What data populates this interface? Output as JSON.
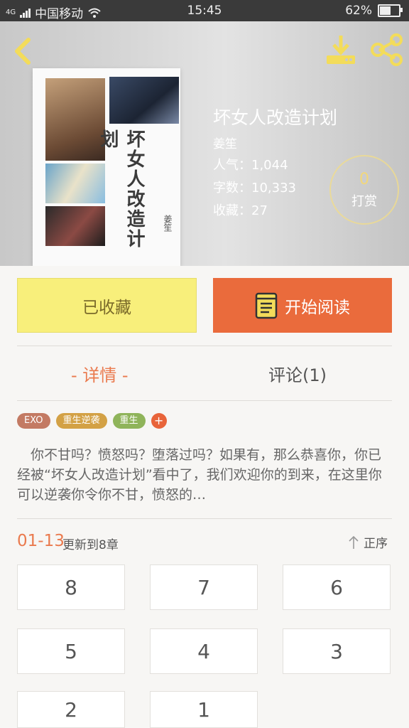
{
  "status": {
    "carrier": "中国移动",
    "network": "4G",
    "time": "15:45",
    "battery": "62%",
    "battery_level": 0.62
  },
  "book": {
    "cover_title": "坏女人改造计划",
    "cover_author": "姜笙",
    "title": "坏女人改造计划",
    "author": "姜笙",
    "popularity": "人气：1,044",
    "words": "字数：10,333",
    "favorites": "收藏：27"
  },
  "tip": {
    "count": "0",
    "label": "打赏"
  },
  "actions": {
    "favorited": "已收藏",
    "read": "开始阅读"
  },
  "tabs": {
    "detail": "- 详情 -",
    "comments": "评论(1)"
  },
  "tags": [
    {
      "label": "EXO",
      "color": "#c37a63"
    },
    {
      "label": "重生逆袭",
      "color": "#d3a145"
    },
    {
      "label": "重生",
      "color": "#8fb45a"
    },
    {
      "label": "+",
      "color": "#e8643a"
    }
  ],
  "description": "你不甘吗？愤怒吗？堕落过吗？如果有，那么恭喜你，你已经被“坏女人改造计划”看中了，我们欢迎你的到来，在这里你可以逆袭你令你不甘，愤怒的…",
  "update": {
    "date": "01-13",
    "text": "更新到8章",
    "sort": "正序"
  },
  "chapters": [
    "8",
    "7",
    "6",
    "5",
    "4",
    "3",
    "2",
    "1"
  ],
  "colors": {
    "accent": "#ea6b3c",
    "fav": "#f8ef7b",
    "icon": "#f3dc5a"
  }
}
